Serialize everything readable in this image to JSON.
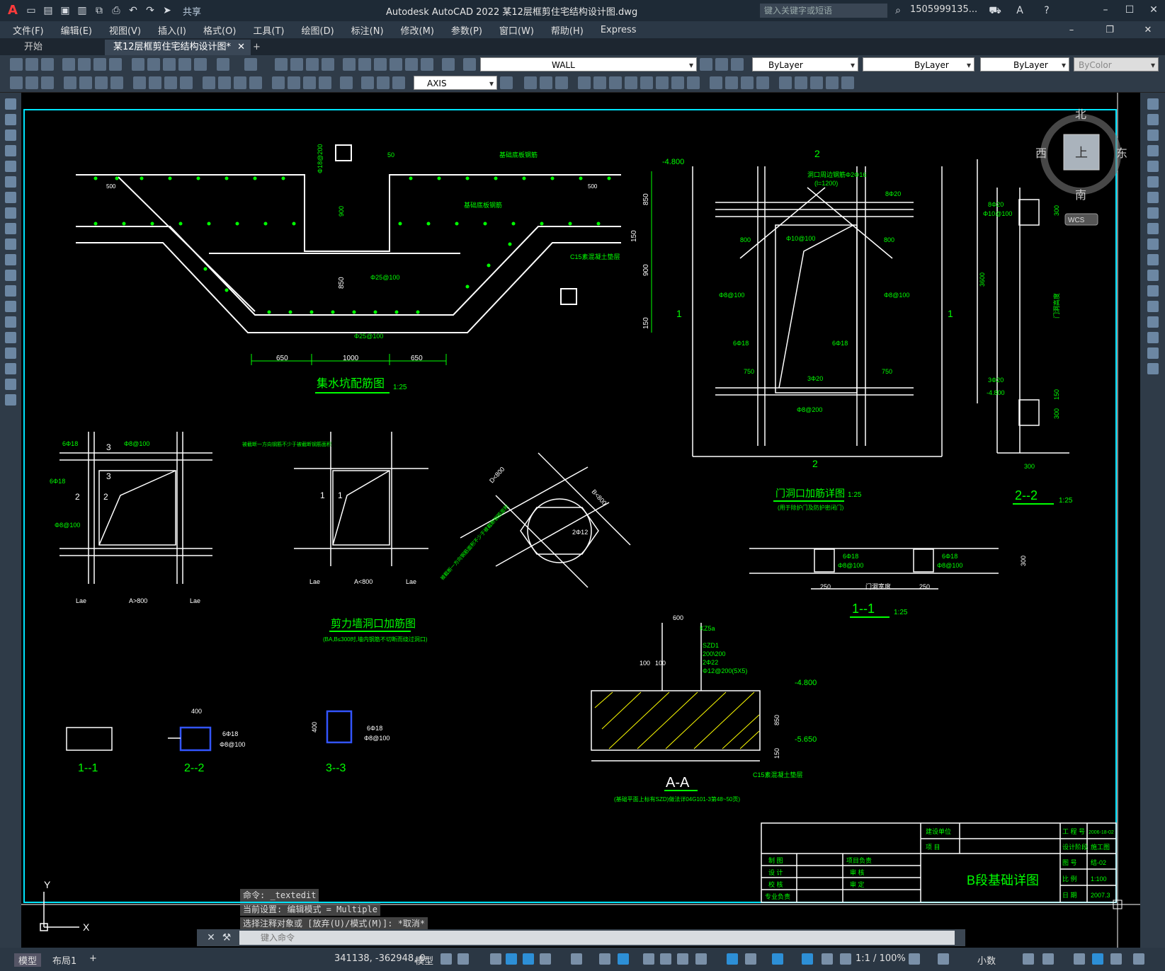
{
  "titlebar": {
    "app_icon": "A",
    "share_label": "共享",
    "title": "Autodesk AutoCAD 2022    某12层框剪住宅结构设计图.dwg",
    "search_placeholder": "键入关键字或短语",
    "user": "1505999135...",
    "icons": [
      "new-icon",
      "open-icon",
      "save-icon",
      "saveas-icon",
      "export-icon",
      "plot-icon",
      "undo-icon",
      "redo-icon",
      "share-icon"
    ]
  },
  "menu": {
    "items": [
      "文件(F)",
      "编辑(E)",
      "视图(V)",
      "插入(I)",
      "格式(O)",
      "工具(T)",
      "绘图(D)",
      "标注(N)",
      "修改(M)",
      "参数(P)",
      "窗口(W)",
      "帮助(H)",
      "Express"
    ]
  },
  "tabs": {
    "start": "开始",
    "drawing": "某12层框剪住宅结构设计图*",
    "add": "+"
  },
  "toolbar": {
    "layer": "WALL",
    "color": "ByLayer",
    "linetype": "ByLayer",
    "lineweight": "ByLayer",
    "plotstyle": "ByColor",
    "textstyle": "AXIS"
  },
  "viewcube": {
    "north": "北",
    "south": "南",
    "east": "东",
    "west": "西",
    "top": "上",
    "wcs": "WCS"
  },
  "drawing": {
    "sump_title": "集水坑配筋图",
    "sump_scale": "1:25",
    "sump_dims": [
      "650",
      "1000",
      "650"
    ],
    "sump_levels": [
      "850",
      "900",
      "150",
      "850",
      "900",
      "150"
    ],
    "sump_notes": [
      "基础底板钢筋",
      "基础底板钢筋",
      "Φ25@100",
      "Φ25@100",
      "C15素混凝土垫层",
      "Φ18@200",
      "900",
      "50",
      "500",
      "500"
    ],
    "door_title": "门洞口加筋详图",
    "door_scale": "1:25",
    "door_note": "(用于除护门及防护密闭门)",
    "door_labels": [
      "2",
      "2",
      "1",
      "1",
      "-4.800",
      "洞口周边钢筋Φ2Φ16",
      "(l=1200)",
      "8Φ20",
      "800",
      "800",
      "Φ10@100",
      "Φ8@100",
      "Φ8@100",
      "6Φ18",
      "6Φ18",
      "750",
      "750",
      "3Φ20",
      "Φ8@200"
    ],
    "section22_title": "2--2",
    "section22_scale": "1:25",
    "section22_labels": [
      "8Φ20",
      "Φ10@100",
      "300",
      "3600",
      "门洞高度",
      "3Φ20",
      "-4.800",
      "150",
      "300",
      "300"
    ],
    "section11_title": "1--1",
    "section11_scale": "1:25",
    "section11_labels": [
      "6Φ18",
      "Φ8@100",
      "6Φ18",
      "Φ8@100",
      "250",
      "门洞宽度",
      "250",
      "300"
    ],
    "wall_title": "剪力墙洞口加筋图",
    "wall_note": "(BA,B≤300时,墙内钢筋不切断而绕过洞口)",
    "wall_labels": [
      "6Φ18",
      "Φ8@100",
      "6Φ18",
      "Φ8@100",
      "3",
      "3",
      "2",
      "2",
      "1",
      "1",
      "Lae",
      "A>800",
      "Lae",
      "Lae",
      "A<800",
      "Lae",
      "D<800",
      "B<800",
      "2Φ12",
      "被截断一方向钢筋不少于被截断钢筋面积",
      "被截断一方向钢筋面积不少于被截断钢筋面积"
    ],
    "aa_title": "A-A",
    "aa_note": "(基础平面上标有SZD)做法详04G101-3第48~50页)",
    "aa_labels": [
      "600",
      "KZ5a",
      "SZD1",
      "200\\200",
      "2Φ22",
      "Φ12@200(5X5)",
      "100",
      "100",
      "-4.800",
      "850",
      "-5.650",
      "150",
      "C15素混凝土垫层"
    ],
    "small_sections": [
      "1--1",
      "2--2",
      "3--3"
    ],
    "small_labels": [
      "400",
      "6Φ18",
      "Φ8@100",
      "400",
      "6Φ18",
      "Φ8@100"
    ],
    "titleblock": {
      "drawing_name": "B段基础详图",
      "rows": [
        {
          "k": "建设单位",
          "v": ""
        },
        {
          "k": "项 目",
          "v": ""
        }
      ],
      "left": [
        [
          "制 图",
          "项目负责"
        ],
        [
          "设 计",
          "审 核"
        ],
        [
          "校 核",
          "审 定"
        ],
        [
          "专业负责",
          ""
        ]
      ],
      "right": [
        [
          "工 程 号",
          "2006-18-02"
        ],
        [
          "设计阶段",
          "施工图"
        ],
        [
          "图 号",
          "结-02"
        ],
        [
          "比 例",
          "1:100"
        ],
        [
          "日 期",
          "2007.3"
        ]
      ]
    }
  },
  "command": {
    "history": [
      "命令: _textedit",
      "当前设置: 编辑模式 = Multiple",
      "选择注释对象或 [放弃(U)/模式(M)]: *取消*"
    ],
    "placeholder": "键入命令"
  },
  "layouts": [
    "模型",
    "布局1",
    "+"
  ],
  "status": {
    "coords": "341138, -362948, 0",
    "space": "模型",
    "annoscale": "1:1 / 100%",
    "units": "小数"
  },
  "ucs": {
    "y": "Y",
    "x": "X"
  }
}
